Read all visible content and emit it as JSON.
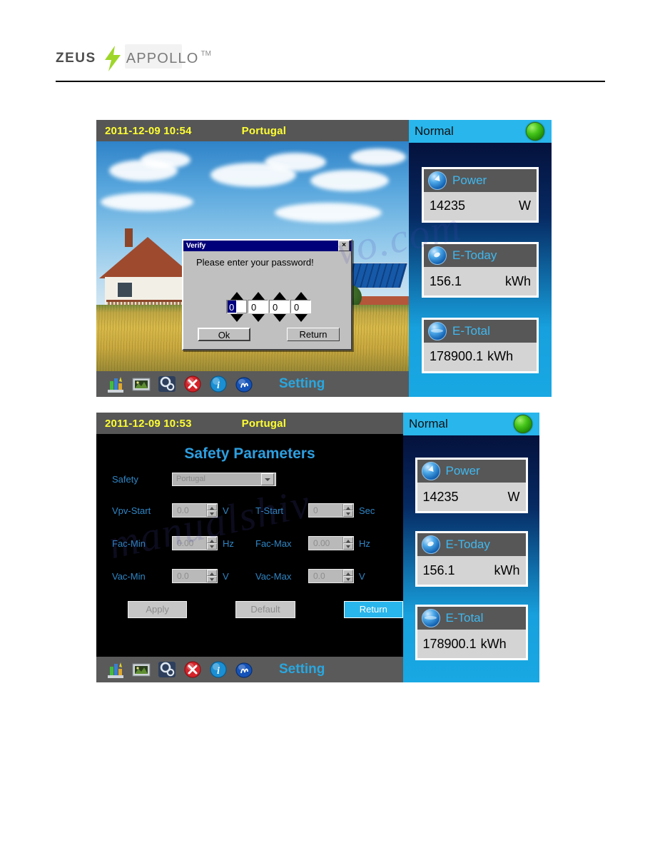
{
  "header": {
    "brand_primary": "ZEUS",
    "brand_secondary": "APPOLLO",
    "trademark": "TM",
    "bolt_icon": "lightning-bolt-icon"
  },
  "screenshot1": {
    "titlebar": {
      "datetime": "2011-12-09 10:54",
      "country": "Portugal"
    },
    "dialog": {
      "title": "Verify",
      "close_label": "×",
      "message": "Please enter your password!",
      "digits": [
        "0",
        "0",
        "0",
        "0"
      ],
      "ok_label": "Ok",
      "return_label": "Return"
    },
    "taskbar": {
      "label": "Setting",
      "icons": [
        "bar-chart-icon",
        "picture-icon",
        "gears-icon",
        "close-error-icon",
        "info-icon",
        "settings-gear-icon"
      ]
    },
    "status": {
      "state": "Normal",
      "led_color": "#3ec21a",
      "cards": [
        {
          "icon": "power-globe-icon",
          "title": "Power",
          "value": "14235",
          "unit": "W"
        },
        {
          "icon": "today-globe-icon",
          "title": "E-Today",
          "value": "156.1",
          "unit": "kWh"
        },
        {
          "icon": "total-globe-icon",
          "title": "E-Total",
          "value": "178900.1",
          "unit": "kWh"
        }
      ]
    }
  },
  "screenshot2": {
    "titlebar": {
      "datetime": "2011-12-09 10:53",
      "country": "Portugal"
    },
    "page_title": "Safety Parameters",
    "safety": {
      "label": "Safety",
      "value": "Portugal"
    },
    "fields": [
      {
        "label": "Vpv-Start",
        "value": "0.0",
        "unit": "V"
      },
      {
        "label": "T-Start",
        "value": "0",
        "unit": "Sec"
      },
      {
        "label": "Fac-Min",
        "value": "0.00",
        "unit": "Hz"
      },
      {
        "label": "Fac-Max",
        "value": "0.00",
        "unit": "Hz"
      },
      {
        "label": "Vac-Min",
        "value": "0.0",
        "unit": "V"
      },
      {
        "label": "Vac-Max",
        "value": "0.0",
        "unit": "V"
      }
    ],
    "buttons": {
      "apply": "Apply",
      "default": "Default",
      "return": "Return"
    },
    "taskbar": {
      "label": "Setting",
      "icons": [
        "bar-chart-icon",
        "picture-icon",
        "gears-icon",
        "close-error-icon",
        "info-icon",
        "settings-gear-icon"
      ]
    },
    "status": {
      "state": "Normal",
      "led_color": "#3ec21a",
      "cards": [
        {
          "icon": "power-globe-icon",
          "title": "Power",
          "value": "14235",
          "unit": "W"
        },
        {
          "icon": "today-globe-icon",
          "title": "E-Today",
          "value": "156.1",
          "unit": "kWh"
        },
        {
          "icon": "total-globe-icon",
          "title": "E-Total",
          "value": "178900.1",
          "unit": "kWh"
        }
      ]
    }
  },
  "watermark": {
    "text1": "vo.com",
    "text2": "manualshiv"
  },
  "colors": {
    "accent_cyan": "#29b6ec",
    "title_yellow": "#ffff33",
    "titlebar_gray": "#565656",
    "card_head_gray": "#575757",
    "card_body_gray": "#d4d4d4"
  }
}
